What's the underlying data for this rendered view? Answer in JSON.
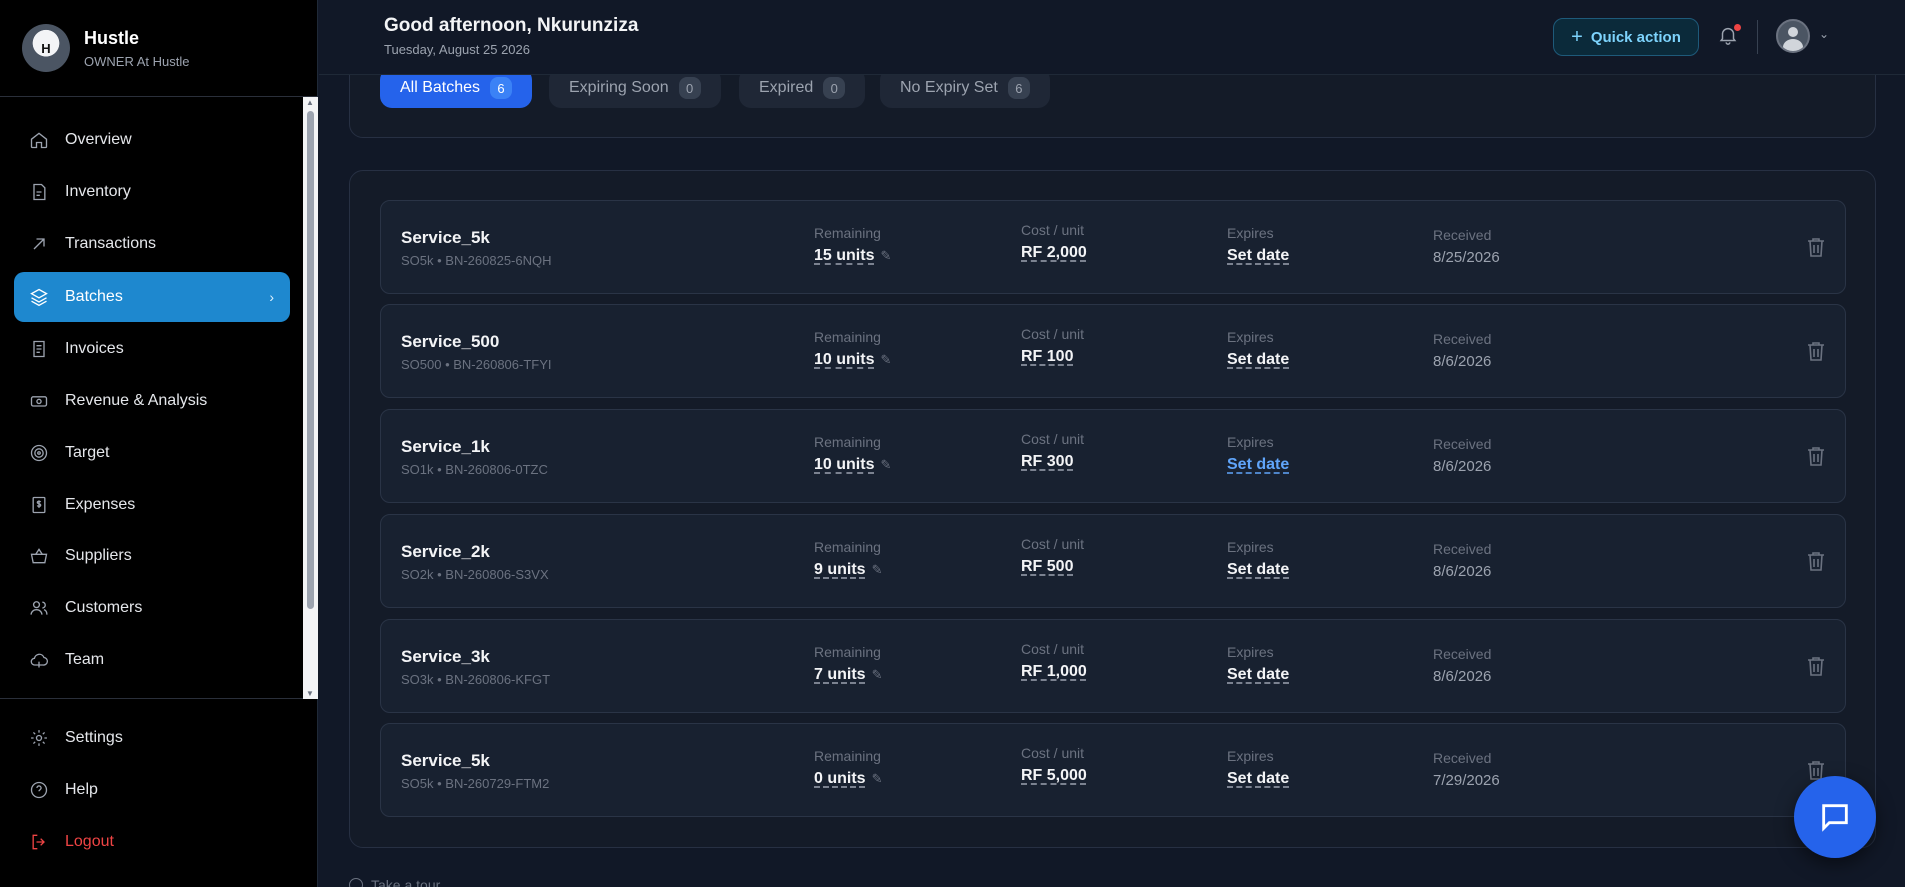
{
  "brand": {
    "name": "Hustle",
    "role": "OWNER At Hustle",
    "logo_text": "H"
  },
  "nav": {
    "items": [
      {
        "label": "Overview",
        "icon": "home-icon"
      },
      {
        "label": "Inventory",
        "icon": "document-icon"
      },
      {
        "label": "Transactions",
        "icon": "arrow-up-right-icon"
      },
      {
        "label": "Batches",
        "icon": "layers-icon",
        "active": true
      },
      {
        "label": "Invoices",
        "icon": "invoice-icon"
      },
      {
        "label": "Revenue & Analysis",
        "icon": "money-icon"
      },
      {
        "label": "Target",
        "icon": "target-icon"
      },
      {
        "label": "Expenses",
        "icon": "dollar-file-icon"
      },
      {
        "label": "Suppliers",
        "icon": "basket-icon"
      },
      {
        "label": "Customers",
        "icon": "users-icon"
      },
      {
        "label": "Team",
        "icon": "cloud-icon"
      }
    ],
    "bottom": [
      {
        "label": "Settings",
        "icon": "gear-icon"
      },
      {
        "label": "Help",
        "icon": "help-icon"
      },
      {
        "label": "Logout",
        "icon": "logout-icon"
      }
    ]
  },
  "header": {
    "greeting": "Good afternoon, Nkurunziza",
    "date": "Tuesday, August 25 2026",
    "quick_action": "Quick action"
  },
  "filters": [
    {
      "label": "All Batches",
      "count": "6",
      "active": true
    },
    {
      "label": "Expiring Soon",
      "count": "0"
    },
    {
      "label": "Expired",
      "count": "0"
    },
    {
      "label": "No Expiry Set",
      "count": "6"
    }
  ],
  "labels": {
    "remaining": "Remaining",
    "cost": "Cost / unit",
    "expires": "Expires",
    "received": "Received"
  },
  "batches": [
    {
      "name": "Service_5k",
      "sub": "SO5k • BN-260825-6NQH",
      "remaining": "15 units",
      "cost": "RF 2,000",
      "expires": "Set date",
      "received": "8/25/2026"
    },
    {
      "name": "Service_500",
      "sub": "SO500 • BN-260806-TFYI",
      "remaining": "10 units",
      "cost": "RF 100",
      "expires": "Set date",
      "received": "8/6/2026"
    },
    {
      "name": "Service_1k",
      "sub": "SO1k • BN-260806-0TZC",
      "remaining": "10 units",
      "cost": "RF 300",
      "expires": "Set date",
      "received": "8/6/2026"
    },
    {
      "name": "Service_2k",
      "sub": "SO2k • BN-260806-S3VX",
      "remaining": "9 units",
      "cost": "RF 500",
      "expires": "Set date",
      "received": "8/6/2026"
    },
    {
      "name": "Service_3k",
      "sub": "SO3k • BN-260806-KFGT",
      "remaining": "7 units",
      "cost": "RF 1,000",
      "expires": "Set date",
      "received": "8/6/2026"
    },
    {
      "name": "Service_5k",
      "sub": "SO5k • BN-260729-FTM2",
      "remaining": "0 units",
      "cost": "RF 5,000",
      "expires": "Set date",
      "received": "7/29/2026"
    }
  ],
  "footer": {
    "tour": "Take a tour"
  },
  "colors": {
    "accent": "#1e88cf",
    "primary": "#2563eb",
    "danger": "#ef4444"
  }
}
